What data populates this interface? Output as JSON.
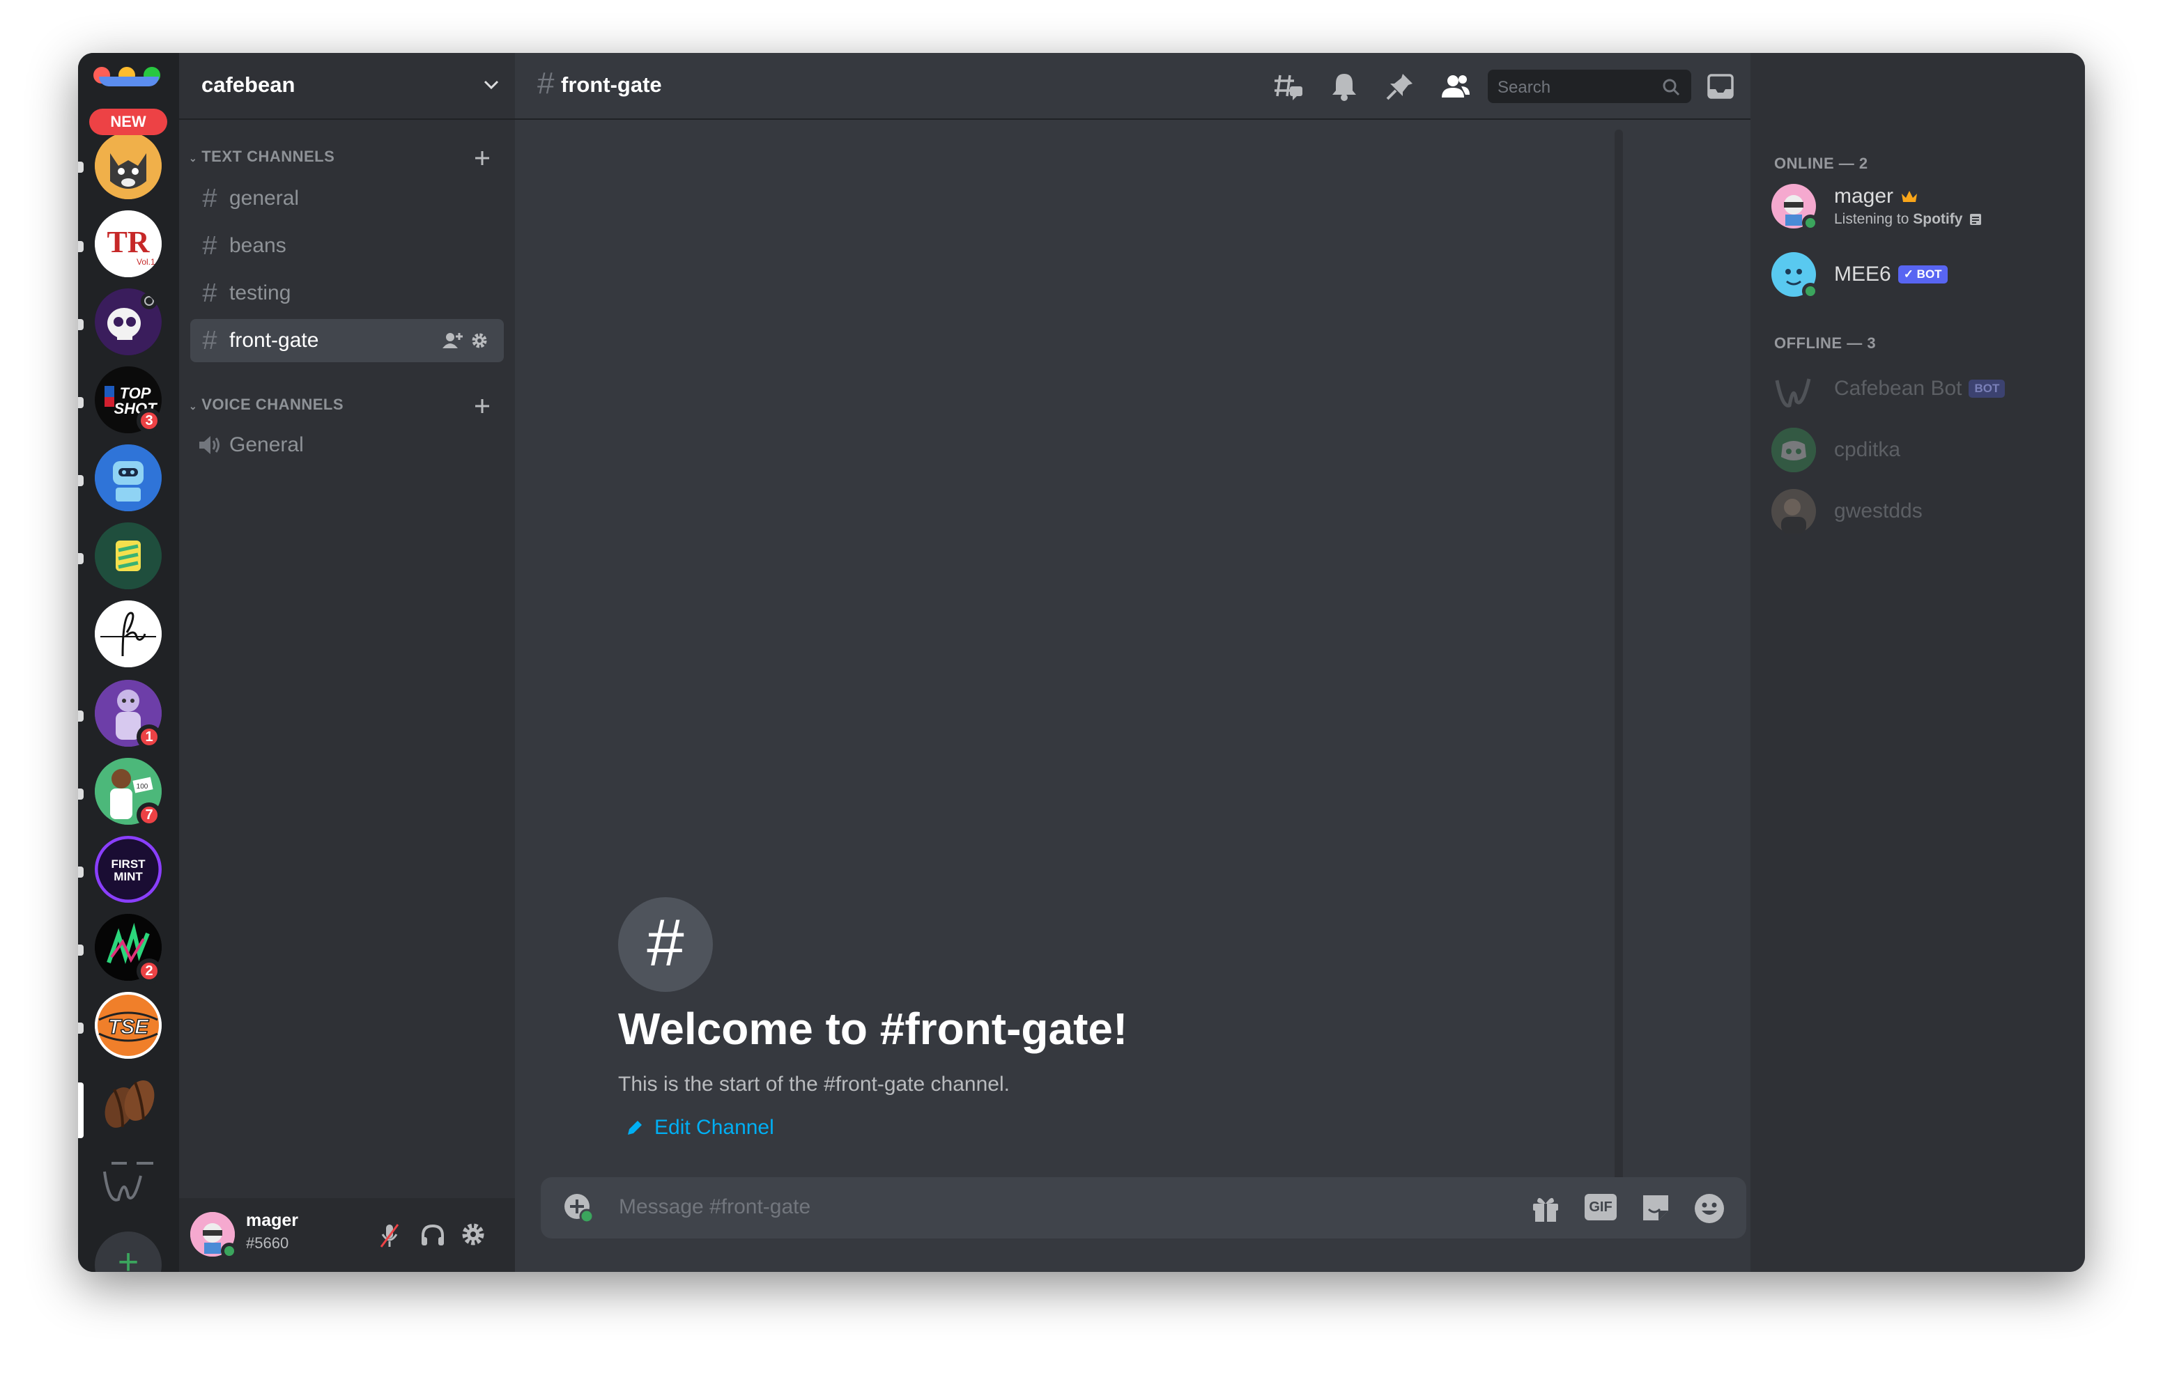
{
  "server": {
    "name": "cafebean",
    "new_label": "NEW"
  },
  "server_list": {
    "badges": [
      "3",
      "1",
      "7",
      "2"
    ],
    "add_label": "+"
  },
  "categories": {
    "text": "TEXT CHANNELS",
    "voice": "VOICE CHANNELS"
  },
  "text_channels": [
    "general",
    "beans",
    "testing",
    "front-gate"
  ],
  "voice_channels": [
    "General"
  ],
  "user": {
    "name": "mager",
    "tag": "#5660"
  },
  "topbar": {
    "channel": "front-gate",
    "search_placeholder": "Search"
  },
  "welcome": {
    "title": "Welcome to #front-gate!",
    "subtitle": "This is the start of the #front-gate channel.",
    "edit": "Edit Channel"
  },
  "composer": {
    "placeholder": "Message #front-gate",
    "gif": "GIF"
  },
  "members": {
    "online_header": "ONLINE — 2",
    "offline_header": "OFFLINE — 3",
    "online": [
      {
        "name": "mager",
        "activity_prefix": "Listening to ",
        "activity_app": "Spotify"
      },
      {
        "name": "MEE6",
        "badge": "✓ BOT"
      }
    ],
    "offline": [
      {
        "name": "Cafebean Bot",
        "badge": "BOT"
      },
      {
        "name": "cpditka"
      },
      {
        "name": "gwestdds"
      }
    ]
  },
  "colors": {
    "accent": "#5865f2",
    "link": "#00aff4",
    "online": "#3ba55d",
    "alert": "#ed4245",
    "add_green": "#3ba55d"
  }
}
